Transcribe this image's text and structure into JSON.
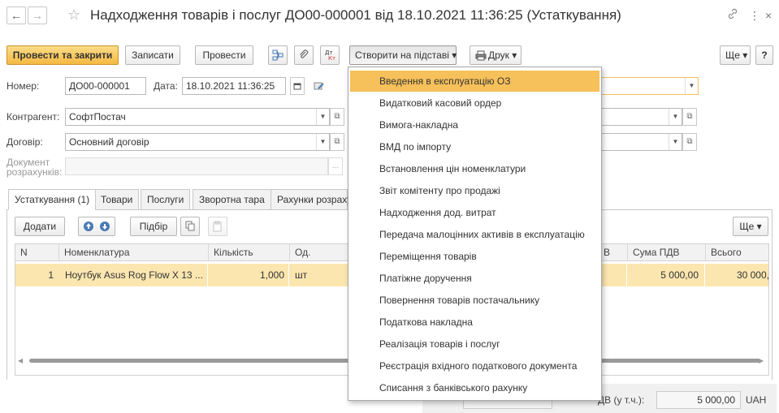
{
  "window": {
    "title": "Надходження товарів і послуг ДО00-000001 від 18.10.2021 11:36:25 (Устаткування)",
    "back_glyph": "←",
    "forward_glyph": "→",
    "star_glyph": "☆",
    "link_glyph": "🔗",
    "more_glyph": "⋮",
    "close_glyph": "×"
  },
  "toolbar": {
    "post_close": "Провести та закрити",
    "save": "Записати",
    "post": "Провести",
    "create_based": "Створити на підставі ▾",
    "print": "Друк ▾",
    "more": "Ще ▾",
    "help": "?"
  },
  "form": {
    "number_label": "Номер:",
    "number_value": "ДО00-000001",
    "date_label": "Дата:",
    "date_value": "18.10.2021 11:36:25",
    "contractor_label": "Контрагент:",
    "contractor_value": "СофтПостач",
    "contract_label": "Договір:",
    "contract_value": "Основний договір",
    "settlement_label_1": "Документ",
    "settlement_label_2": "розрахунків:",
    "dots": "..."
  },
  "tabs": [
    {
      "label": "Устаткування (1)"
    },
    {
      "label": "Товари"
    },
    {
      "label": "Послуги"
    },
    {
      "label": "Зворотна тара"
    },
    {
      "label": "Рахунки розраху"
    }
  ],
  "grid_toolbar": {
    "add": "Додати",
    "pick": "Підбір",
    "more": "Ще ▾"
  },
  "grid": {
    "columns": [
      "N",
      "Номенклатура",
      "Кількість",
      "Од.",
      "В",
      "Сума ПДВ",
      "Всього"
    ],
    "rows": [
      {
        "n": "1",
        "item": "Ноутбук Asus Rog Flow X 13 ...",
        "qty": "1,000",
        "unit": "шт",
        "vat": "5 000,00",
        "total": "30 000,"
      }
    ]
  },
  "footer": {
    "vat_label": "ДВ (у т.ч.):",
    "vat_value": "5 000,00",
    "currency": "UAH"
  },
  "menu": {
    "items": [
      "Введення в експлуатацію ОЗ",
      "Видатковий касовий ордер",
      "Вимога-накладна",
      "ВМД по імпорту",
      "Встановлення цін номенклатури",
      "Звіт комітенту про продажі",
      "Надходження дод. витрат",
      "Передача малоцінних активів в експлуатацію",
      "Переміщення товарів",
      "Платіжне доручення",
      "Повернення товарів постачальнику",
      "Податкова накладна",
      "Реалізація товарів і послуг",
      "Реєстрація вхідного податкового документа",
      "Списання з банківського рахунку"
    ]
  }
}
